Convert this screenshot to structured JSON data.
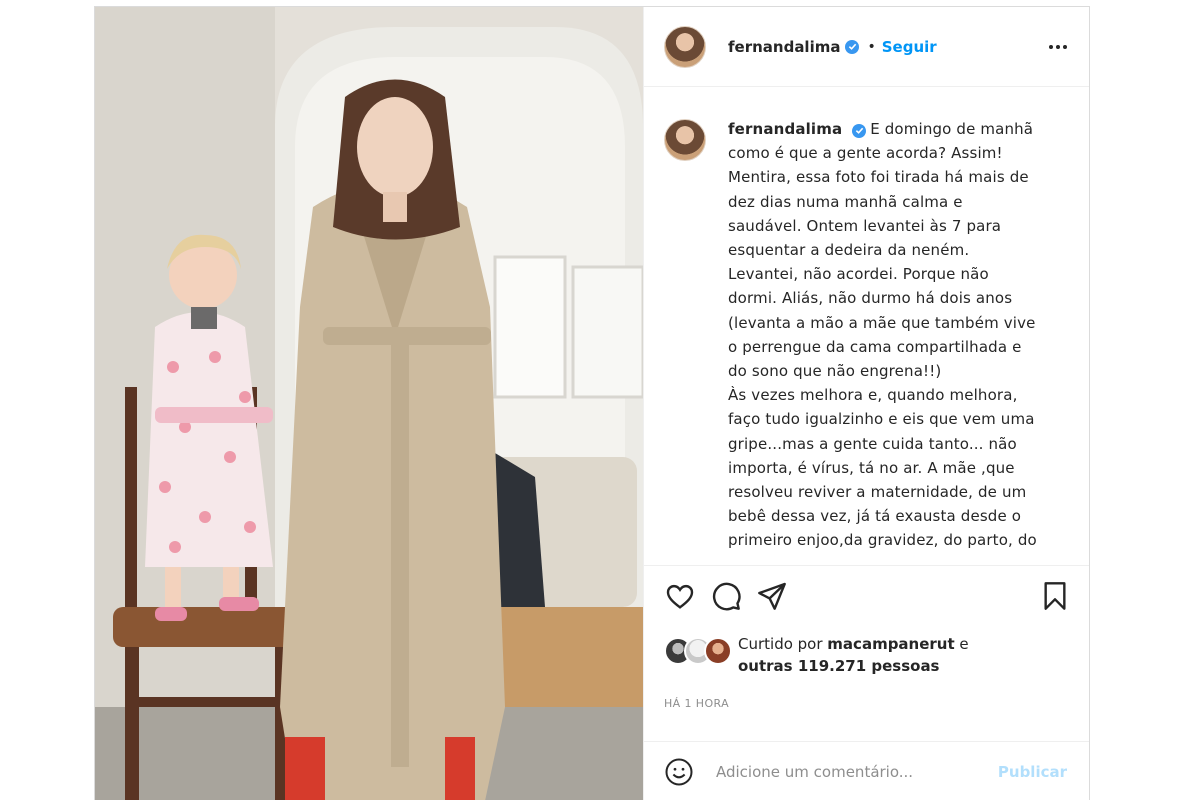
{
  "post": {
    "username": "fernandalima",
    "follow_label": "Seguir",
    "dot_separator": "•",
    "caption_username": "fernandalima",
    "caption_text": "E domingo de manhã como é que a gente acorda? Assim! Mentira, essa foto foi tirada há mais de dez dias numa manhã calma e saudável. Ontem levantei às 7 para esquentar a dedeira da neném. Levantei, não acordei. Porque não dormi. Aliás, não durmo há dois anos (levanta a mão a mãe que também vive o perrengue da cama compartilhada e do sono que não engrena!!)\nÀs vezes melhora e, quando melhora, faço tudo igualzinho e eis que vem uma gripe...mas a gente cuida tanto... não importa, é vírus, tá no ar. A mãe ,que resolveu reviver a maternidade, de um bebê dessa vez, já tá exausta desde o primeiro enjoo,da gravidez, do parto, do",
    "likes": {
      "prefix": "Curtido por ",
      "user": "macampanerut",
      "middle": " e",
      "others": "outras 119.271 pessoas"
    },
    "timestamp": "Há 1 hora",
    "comment": {
      "placeholder": "Adicione um comentário...",
      "value": "",
      "publish_label": "Publicar"
    }
  },
  "icons": {
    "header_avatar": "profile-avatar",
    "verified": "verified-badge-icon",
    "more": "more-options-icon",
    "like": "heart-icon",
    "comment": "comment-icon",
    "share": "share-icon",
    "save": "bookmark-icon",
    "emoji": "emoji-icon"
  },
  "colors": {
    "accent_blue": "#0095f6",
    "verified_blue": "#3897f0",
    "publish_disabled": "#b2dffc",
    "border": "#dbdbdb",
    "muted_text": "#8e8e8e"
  }
}
